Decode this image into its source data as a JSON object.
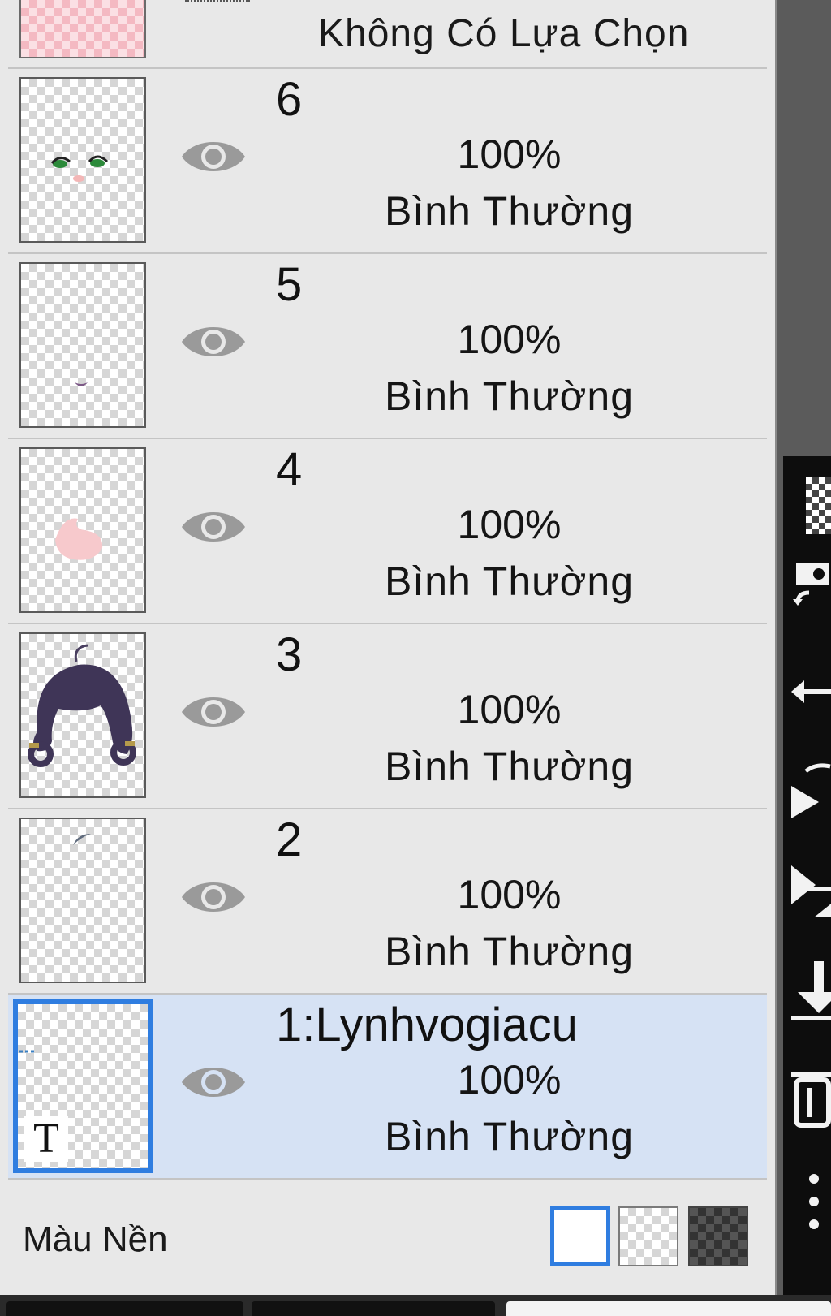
{
  "selection_row": {
    "label": "Không Có Lựa Chọn"
  },
  "layers": [
    {
      "name": "6",
      "opacity": "100%",
      "blend_mode": "Bình Thường",
      "visible": true
    },
    {
      "name": "5",
      "opacity": "100%",
      "blend_mode": "Bình Thường",
      "visible": true
    },
    {
      "name": "4",
      "opacity": "100%",
      "blend_mode": "Bình Thường",
      "visible": true
    },
    {
      "name": "3",
      "opacity": "100%",
      "blend_mode": "Bình Thường",
      "visible": true
    },
    {
      "name": "2",
      "opacity": "100%",
      "blend_mode": "Bình Thường",
      "visible": true
    },
    {
      "name": "1:Lynhvogiacu",
      "opacity": "100%",
      "blend_mode": "Bình Thường",
      "visible": true,
      "selected": true,
      "text_layer_badge": "T"
    }
  ],
  "background": {
    "label": "Màu Nền",
    "options": [
      "white",
      "transparent",
      "dark-checker"
    ],
    "selected": "white"
  },
  "colors": {
    "accent": "#2f7de0",
    "selected_row": "#d6e2f4",
    "panel": "#e8e8e8"
  },
  "toolbar": {
    "icons": [
      "checker-icon",
      "transform-icon",
      "flip-icon",
      "rotate-icon",
      "move-down-icon",
      "merge-icon",
      "delete-icon",
      "more-icon"
    ]
  }
}
